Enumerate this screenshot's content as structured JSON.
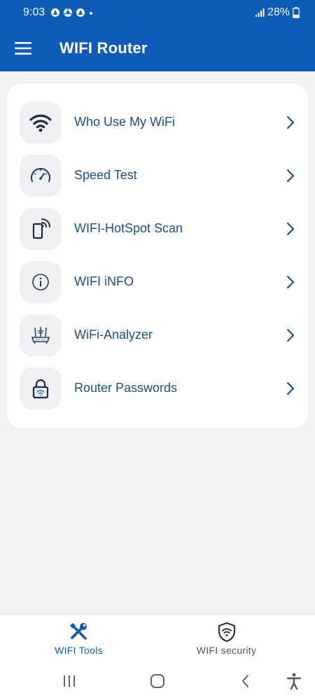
{
  "status_bar": {
    "time": "9:03",
    "battery": "28%"
  },
  "appbar": {
    "title": "WIFI Router",
    "menu_icon": "hamburger-menu-icon"
  },
  "menu": [
    {
      "label": "Who Use My WiFi",
      "icon": "wifi-icon"
    },
    {
      "label": "Speed Test",
      "icon": "speedometer-icon"
    },
    {
      "label": "WIFI-HotSpot Scan",
      "icon": "hotspot-scan-icon"
    },
    {
      "label": "WIFI iNFO",
      "icon": "info-icon"
    },
    {
      "label": "WiFi-Analyzer",
      "icon": "router-icon"
    },
    {
      "label": "Router Passwords",
      "icon": "lock-wifi-icon"
    }
  ],
  "bottom_nav": [
    {
      "label": "WIFI Tools",
      "icon": "tools-icon",
      "active": true
    },
    {
      "label": "WIFI security",
      "icon": "shield-wifi-icon",
      "active": false
    }
  ],
  "colors": {
    "primary": "#0d5cb8",
    "label": "#1d4f8e",
    "background": "#f1f2f4"
  }
}
